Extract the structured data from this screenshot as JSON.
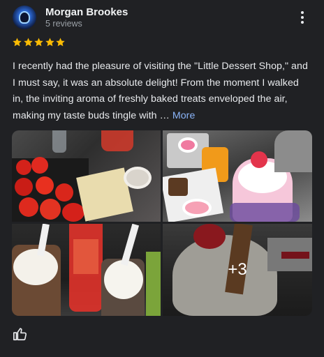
{
  "reviewer": {
    "name": "Morgan Brookes",
    "reviews_count": "5 reviews"
  },
  "rating": 5,
  "colors": {
    "star": "#fbbc04",
    "link": "#8ab4f8",
    "background": "#202124"
  },
  "review": {
    "text": "I recently had the pleasure of visiting the \"Little Dessert Shop,\" and I must say, it was an absolute delight! From the moment I walked in, the inviting aroma of freshly baked treats enveloped the air, making my taste buds tingle with … ",
    "more_label": "More"
  },
  "photos": {
    "more_count": "+3"
  },
  "icons": {
    "avatar": "avatar-image",
    "menu": "more-vert-icon",
    "star": "star-icon",
    "like": "thumb-up-icon"
  }
}
